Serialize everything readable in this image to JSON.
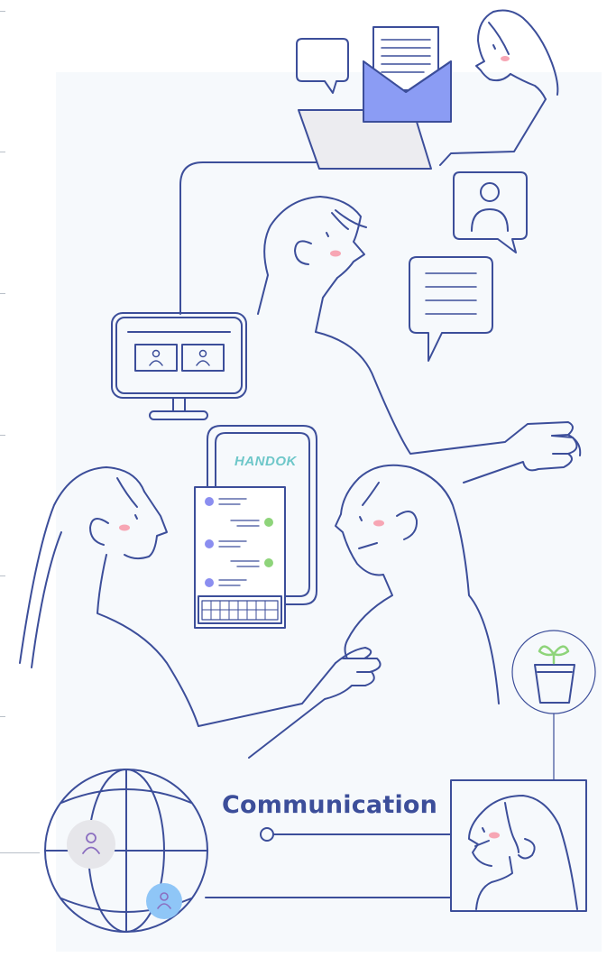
{
  "scene": {
    "label": "Communication",
    "brand_text": "HANDOK"
  },
  "colors": {
    "line": "#3c4e9a",
    "panel_bg": "#f6f9fc",
    "envelope": "#8b9cf4",
    "cheek": "#f7a6b4",
    "dot_purple": "#8b8ef0",
    "dot_green": "#8ed47a",
    "plant": "#8ed47a",
    "avatar_gray": "#e6e6ea",
    "avatar_blue": "#8fc6f7"
  },
  "icons": [
    "chat-bubble-icon",
    "envelope-icon",
    "laptop-icon",
    "profile-card-icon",
    "message-bubble-icon",
    "monitor-icon",
    "phone-icon",
    "plant-icon",
    "globe-icon",
    "user-avatar-icon"
  ]
}
